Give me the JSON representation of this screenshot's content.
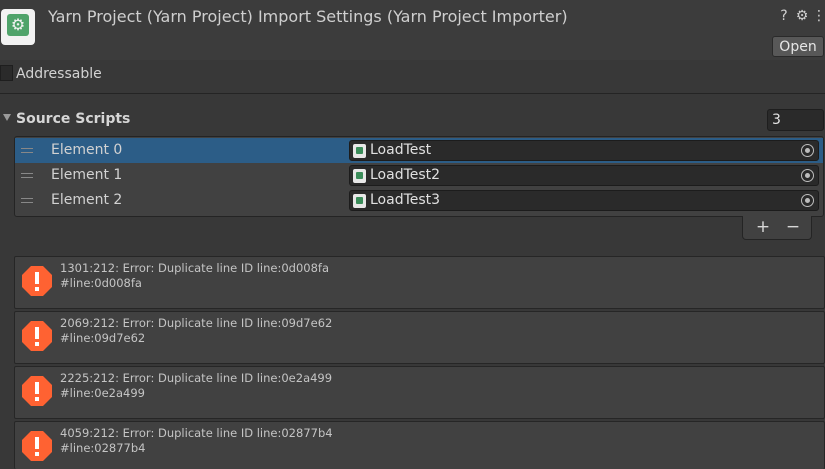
{
  "header": {
    "title": "Yarn Project (Yarn Project) Import Settings (Yarn Project Importer)",
    "help_icon": "?",
    "settings_icon": "⚙",
    "more_icon": "⋮",
    "open_label": "Open"
  },
  "addressable": {
    "label": "Addressable",
    "checked": false
  },
  "source_scripts": {
    "label": "Source Scripts",
    "count": "3",
    "elements": [
      {
        "label": "Element 0",
        "value": "LoadTest",
        "selected": true
      },
      {
        "label": "Element 1",
        "value": "LoadTest2",
        "selected": false
      },
      {
        "label": "Element 2",
        "value": "LoadTest3",
        "selected": false
      }
    ],
    "add_label": "+",
    "remove_label": "−"
  },
  "errors": [
    {
      "message": "1301:212: Error: Duplicate line ID line:0d008fa",
      "detail": "#line:0d008fa"
    },
    {
      "message": "2069:212: Error: Duplicate line ID line:09d7e62",
      "detail": "#line:09d7e62"
    },
    {
      "message": "2225:212: Error: Duplicate line ID line:0e2a499",
      "detail": "#line:0e2a499"
    },
    {
      "message": "4059:212: Error: Duplicate line ID line:02877b4",
      "detail": "#line:02877b4"
    }
  ],
  "colors": {
    "background": "#383838",
    "selection": "#2c5d87",
    "error_icon": "#ff6232"
  }
}
